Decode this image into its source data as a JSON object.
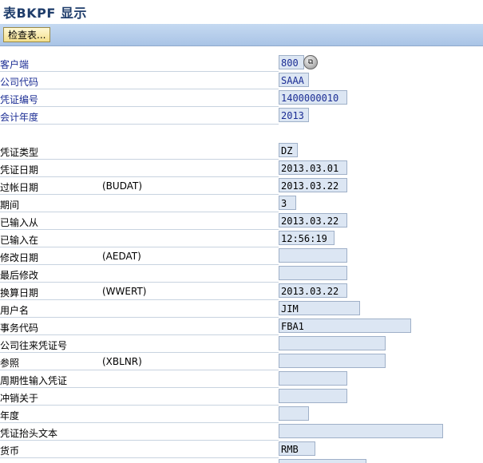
{
  "window": {
    "title": "表BKPF 显示"
  },
  "toolbar": {
    "check_table_label": "检查表..."
  },
  "fields": [
    {
      "label": "客户端",
      "tech": "",
      "value": "800",
      "key": true
    },
    {
      "label": "公司代码",
      "tech": "",
      "value": "SAAA",
      "key": true
    },
    {
      "label": "凭证编号",
      "tech": "",
      "value": "1400000010",
      "key": true
    },
    {
      "label": "会计年度",
      "tech": "",
      "value": "2013",
      "key": true
    },
    {
      "label": "凭证类型",
      "tech": "",
      "value": "DZ",
      "key": false
    },
    {
      "label": "凭证日期",
      "tech": "",
      "value": "2013.03.01",
      "key": false
    },
    {
      "label": "过帐日期",
      "tech": "(BUDAT)",
      "value": "2013.03.22",
      "key": false
    },
    {
      "label": "期间",
      "tech": "",
      "value": "3",
      "key": false
    },
    {
      "label": "已输入从",
      "tech": "",
      "value": "2013.03.22",
      "key": false
    },
    {
      "label": "已输入在",
      "tech": "",
      "value": "12:56:19",
      "key": false
    },
    {
      "label": "修改日期",
      "tech": "(AEDAT)",
      "value": "",
      "key": false
    },
    {
      "label": "最后修改",
      "tech": "",
      "value": "",
      "key": false
    },
    {
      "label": "换算日期",
      "tech": "(WWERT)",
      "value": "2013.03.22",
      "key": false
    },
    {
      "label": "用户名",
      "tech": "",
      "value": "JIM",
      "key": false
    },
    {
      "label": "事务代码",
      "tech": "",
      "value": "FBA1",
      "key": false
    },
    {
      "label": "公司往来凭证号",
      "tech": "",
      "value": "",
      "key": false
    },
    {
      "label": "参照",
      "tech": "(XBLNR)",
      "value": "",
      "key": false
    },
    {
      "label": "周期性输入凭证",
      "tech": "",
      "value": "",
      "key": false
    },
    {
      "label": "冲销关于",
      "tech": "",
      "value": "",
      "key": false
    },
    {
      "label": "年度",
      "tech": "",
      "value": "",
      "key": false
    },
    {
      "label": "凭证抬头文本",
      "tech": "",
      "value": "",
      "key": false
    },
    {
      "label": "货币",
      "tech": "",
      "value": "RMB",
      "key": false
    }
  ],
  "icons": {
    "lookup": "value-help-icon"
  }
}
